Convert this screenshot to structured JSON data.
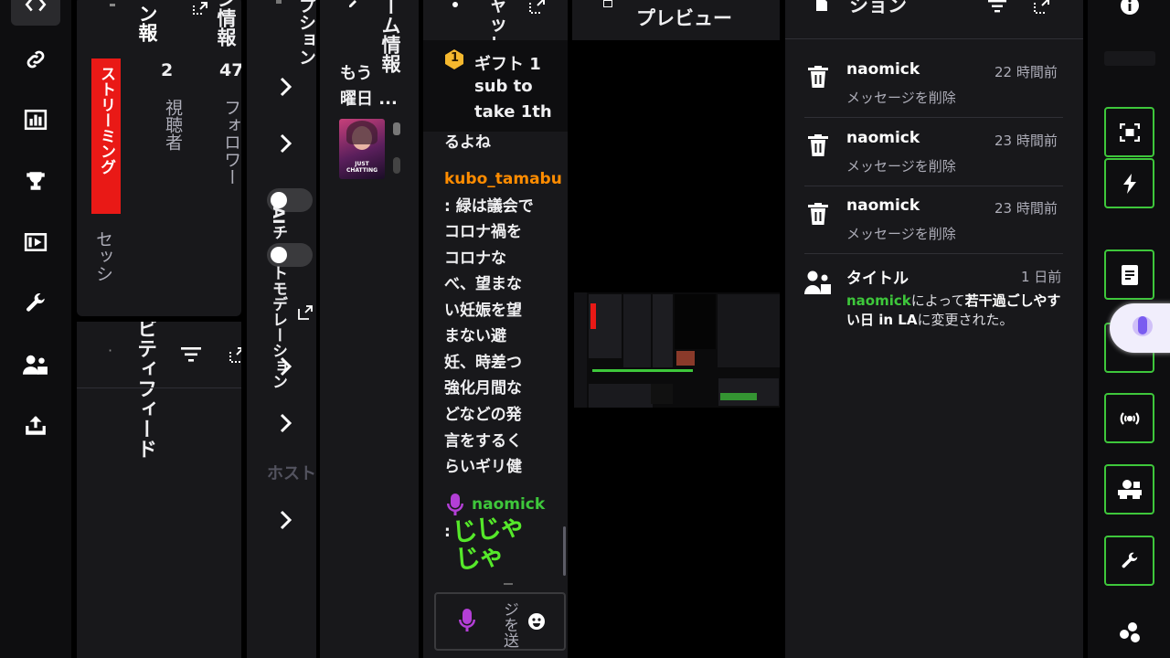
{
  "colors": {
    "accent_green": "#3ec73b",
    "live_red": "#e91916",
    "chat_orange": "#ff8c00",
    "mod_green": "#3ec73b",
    "mic_purple": "#b33fd6"
  },
  "left_rail": {
    "items": [
      {
        "icon": "code-icon"
      },
      {
        "icon": "link-icon"
      },
      {
        "icon": "bar-chart-icon"
      },
      {
        "icon": "trophy-icon"
      },
      {
        "icon": "video-icon"
      },
      {
        "icon": "wrench-icon"
      },
      {
        "icon": "users-icon"
      },
      {
        "icon": "upload-icon"
      }
    ]
  },
  "session_panel": {
    "title_frag": "ン情報",
    "title_frag2": "ン報",
    "live_badge": "ストリーミング",
    "viewers_count": "2",
    "viewers_label": "視聴者",
    "followers_count": "47",
    "followers_label": "フォロワー",
    "session_label": "セッシ"
  },
  "activity_panel": {
    "title": "ビティフィード",
    "dot": "·"
  },
  "options_panel": {
    "title_frag": "プション",
    "ai_label": "AIチ",
    "automod_label": "トモデレーション",
    "host_label": "ホスト"
  },
  "stream_info_panel": {
    "title_frag": "ーム情報",
    "desc": "もう",
    "desc2": "曜日 ...",
    "thumb_text": "JUST CHATTING"
  },
  "chat_panel": {
    "title_frag": "ャット",
    "pinned_badge": "1",
    "pinned_lines": [
      "ギフト 1",
      "sub to",
      "take 1th"
    ],
    "prev_text": "るよね",
    "message1_user": "kubo_tamabu",
    "message1_lines": [
      ": 緑は議会で",
      "コロナ禍を",
      "コロナな",
      "べ、望まな",
      "い妊娠を望",
      "まない避",
      "妊、時差つ",
      "強化月間な",
      "どなどの発",
      "言をするく",
      "らいギリ健"
    ],
    "message2_user": "naomick",
    "message2_prefix": ":",
    "message2_emote": "じじゃじゃ",
    "input_placeholder": "ジを送"
  },
  "preview_panel": {
    "title_frag": "プレビュー"
  },
  "mod_panel": {
    "title_frag": "ション",
    "actions": [
      {
        "user": "naomick",
        "time": "22 時間前",
        "action": "メッセージを削除"
      },
      {
        "user": "naomick",
        "time": "23 時間前",
        "action": "メッセージを削除"
      },
      {
        "user": "naomick",
        "time": "23 時間前",
        "action": "メッセージを削除"
      }
    ],
    "title_change": {
      "label": "タイトル",
      "time": "1 日前",
      "user": "naomick",
      "text_mid": "によって",
      "new_title": "若干過ごしやすい日 in LA",
      "text_end": "に変更された。"
    }
  },
  "right_rail": {
    "items": [
      {
        "icon": "info-icon"
      },
      {
        "icon": "screenshot-icon"
      },
      {
        "icon": "lightning-icon"
      },
      {
        "icon": "notes-icon"
      },
      {
        "icon": "mic-icon"
      },
      {
        "icon": "broadcast-icon"
      },
      {
        "icon": "camera-icon"
      },
      {
        "icon": "wrench-icon"
      },
      {
        "icon": "extensions-icon"
      }
    ]
  }
}
